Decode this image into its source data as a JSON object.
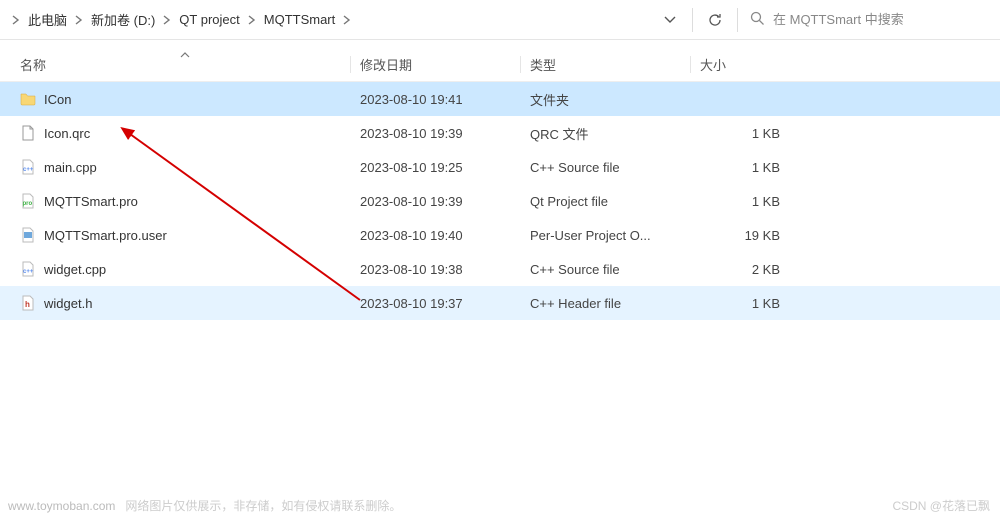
{
  "breadcrumb": {
    "items": [
      {
        "label": "此电脑"
      },
      {
        "label": "新加卷 (D:)"
      },
      {
        "label": "QT project"
      },
      {
        "label": "MQTTSmart"
      }
    ]
  },
  "search": {
    "placeholder": "在 MQTTSmart 中搜索"
  },
  "columns": {
    "name": "名称",
    "date": "修改日期",
    "type": "类型",
    "size": "大小"
  },
  "rows": [
    {
      "icon": "folder",
      "name": "ICon",
      "date": "2023-08-10 19:41",
      "type": "文件夹",
      "size": "",
      "selected": true
    },
    {
      "icon": "file",
      "name": "Icon.qrc",
      "date": "2023-08-10 19:39",
      "type": "QRC 文件",
      "size": "1 KB"
    },
    {
      "icon": "cpp",
      "name": "main.cpp",
      "date": "2023-08-10 19:25",
      "type": "C++ Source file",
      "size": "1 KB"
    },
    {
      "icon": "pro",
      "name": "MQTTSmart.pro",
      "date": "2023-08-10 19:39",
      "type": "Qt Project file",
      "size": "1 KB"
    },
    {
      "icon": "user",
      "name": "MQTTSmart.pro.user",
      "date": "2023-08-10 19:40",
      "type": "Per-User Project O...",
      "size": "19 KB"
    },
    {
      "icon": "cpp",
      "name": "widget.cpp",
      "date": "2023-08-10 19:38",
      "type": "C++ Source file",
      "size": "2 KB"
    },
    {
      "icon": "h",
      "name": "widget.h",
      "date": "2023-08-10 19:37",
      "type": "C++ Header file",
      "size": "1 KB",
      "hover": true
    }
  ],
  "watermark": {
    "site": "www.toymoban.com",
    "note": "网络图片仅供展示，非存储，如有侵权请联系删除。"
  },
  "credit": "CSDN @花落已飘"
}
